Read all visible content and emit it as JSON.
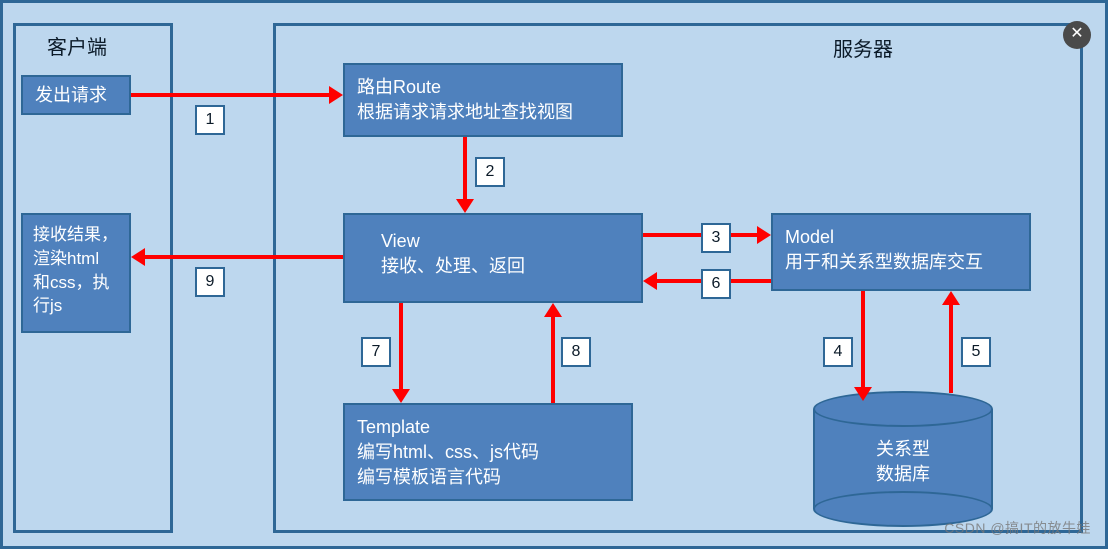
{
  "containers": {
    "client_title": "客户端",
    "server_title": "服务器"
  },
  "nodes": {
    "request": "发出请求",
    "result_line1": "接收结果，",
    "result_line2": "渲染html",
    "result_line3": "和css，执",
    "result_line4": "行js",
    "route_line1": "路由Route",
    "route_line2": "根据请求请求地址查找视图",
    "view_line1": "View",
    "view_line2": "接收、处理、返回",
    "model_line1": "Model",
    "model_line2": "用于和关系型数据库交互",
    "template_line1": "Template",
    "template_line2": "编写html、css、js代码",
    "template_line3": "编写模板语言代码",
    "db_line1": "关系型",
    "db_line2": "数据库"
  },
  "steps": {
    "s1": "1",
    "s2": "2",
    "s3": "3",
    "s4": "4",
    "s5": "5",
    "s6": "6",
    "s7": "7",
    "s8": "8",
    "s9": "9"
  },
  "close_label": "✕",
  "watermark": "CSDN @搞IT的放牛娃",
  "colors": {
    "bg": "#bdd7ee",
    "node": "#4f81bd",
    "border": "#2e6796",
    "arrow": "#ff0000",
    "text_light": "#ffffff",
    "text_dark": "#0b1a28"
  }
}
